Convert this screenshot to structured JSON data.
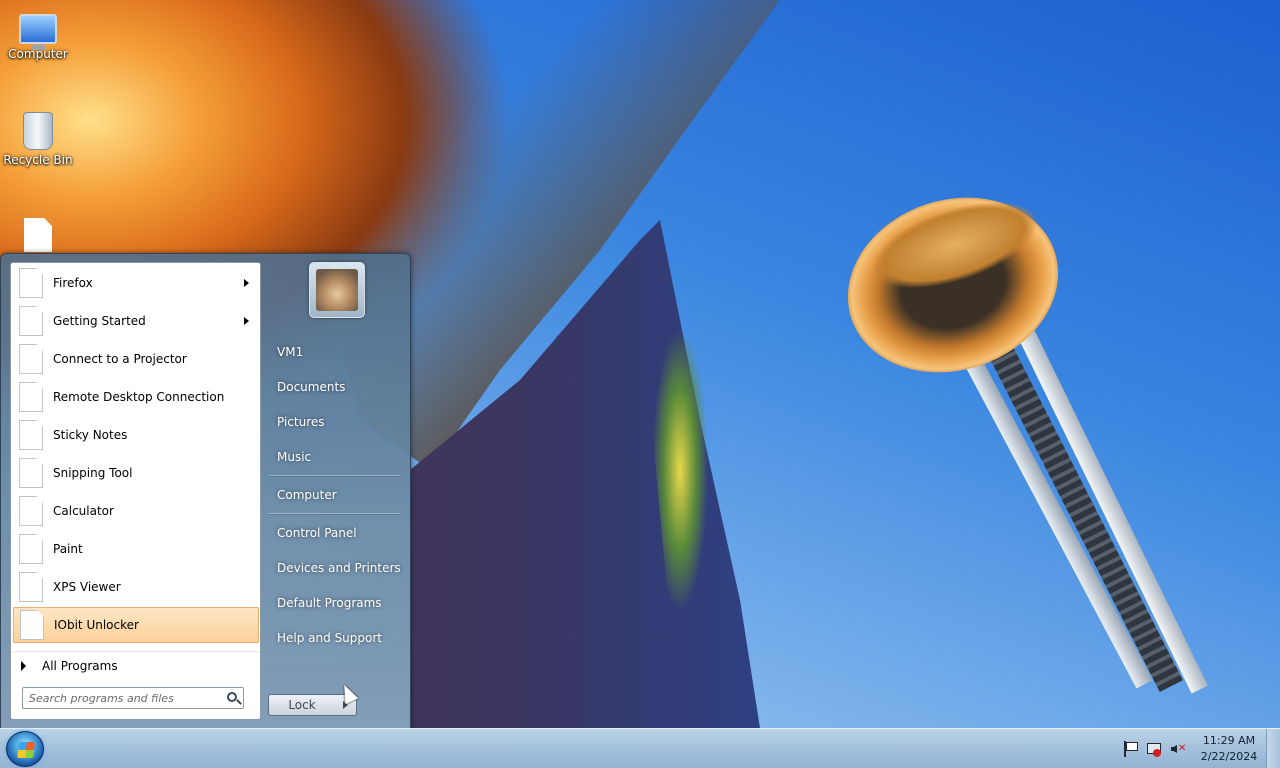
{
  "desktop": {
    "icons": [
      {
        "label": "Computer",
        "icon": "computer-icon"
      },
      {
        "label": "Recycle Bin",
        "icon": "recycle-bin-icon"
      },
      {
        "label": "",
        "icon": "file-icon"
      }
    ]
  },
  "start_menu": {
    "programs": [
      {
        "label": "Firefox",
        "has_submenu": true
      },
      {
        "label": "Getting Started",
        "has_submenu": true
      },
      {
        "label": "Connect to a Projector",
        "has_submenu": false
      },
      {
        "label": "Remote Desktop Connection",
        "has_submenu": false
      },
      {
        "label": "Sticky Notes",
        "has_submenu": false
      },
      {
        "label": "Snipping Tool",
        "has_submenu": false
      },
      {
        "label": "Calculator",
        "has_submenu": false
      },
      {
        "label": "Paint",
        "has_submenu": false
      },
      {
        "label": "XPS Viewer",
        "has_submenu": false
      },
      {
        "label": "IObit Unlocker",
        "has_submenu": false,
        "highlighted": true
      }
    ],
    "all_programs_label": "All Programs",
    "search_placeholder": "Search programs and files",
    "user_name": "VM1",
    "places": [
      {
        "label": "VM1"
      },
      {
        "label": "Documents"
      },
      {
        "label": "Pictures"
      },
      {
        "label": "Music"
      },
      {
        "label": "Computer"
      },
      {
        "label": "Control Panel"
      },
      {
        "label": "Devices and Printers"
      },
      {
        "label": "Default Programs"
      },
      {
        "label": "Help and Support"
      }
    ],
    "lock_label": "Lock"
  },
  "taskbar": {
    "time": "11:29 AM",
    "date": "2/22/2024",
    "tray_icons": [
      "action-center-flag-icon",
      "network-error-icon",
      "volume-muted-icon"
    ]
  },
  "colors": {
    "highlight": "#fbd19a",
    "taskbar": "#a4c0dc",
    "sky": "#2a6fd6"
  }
}
